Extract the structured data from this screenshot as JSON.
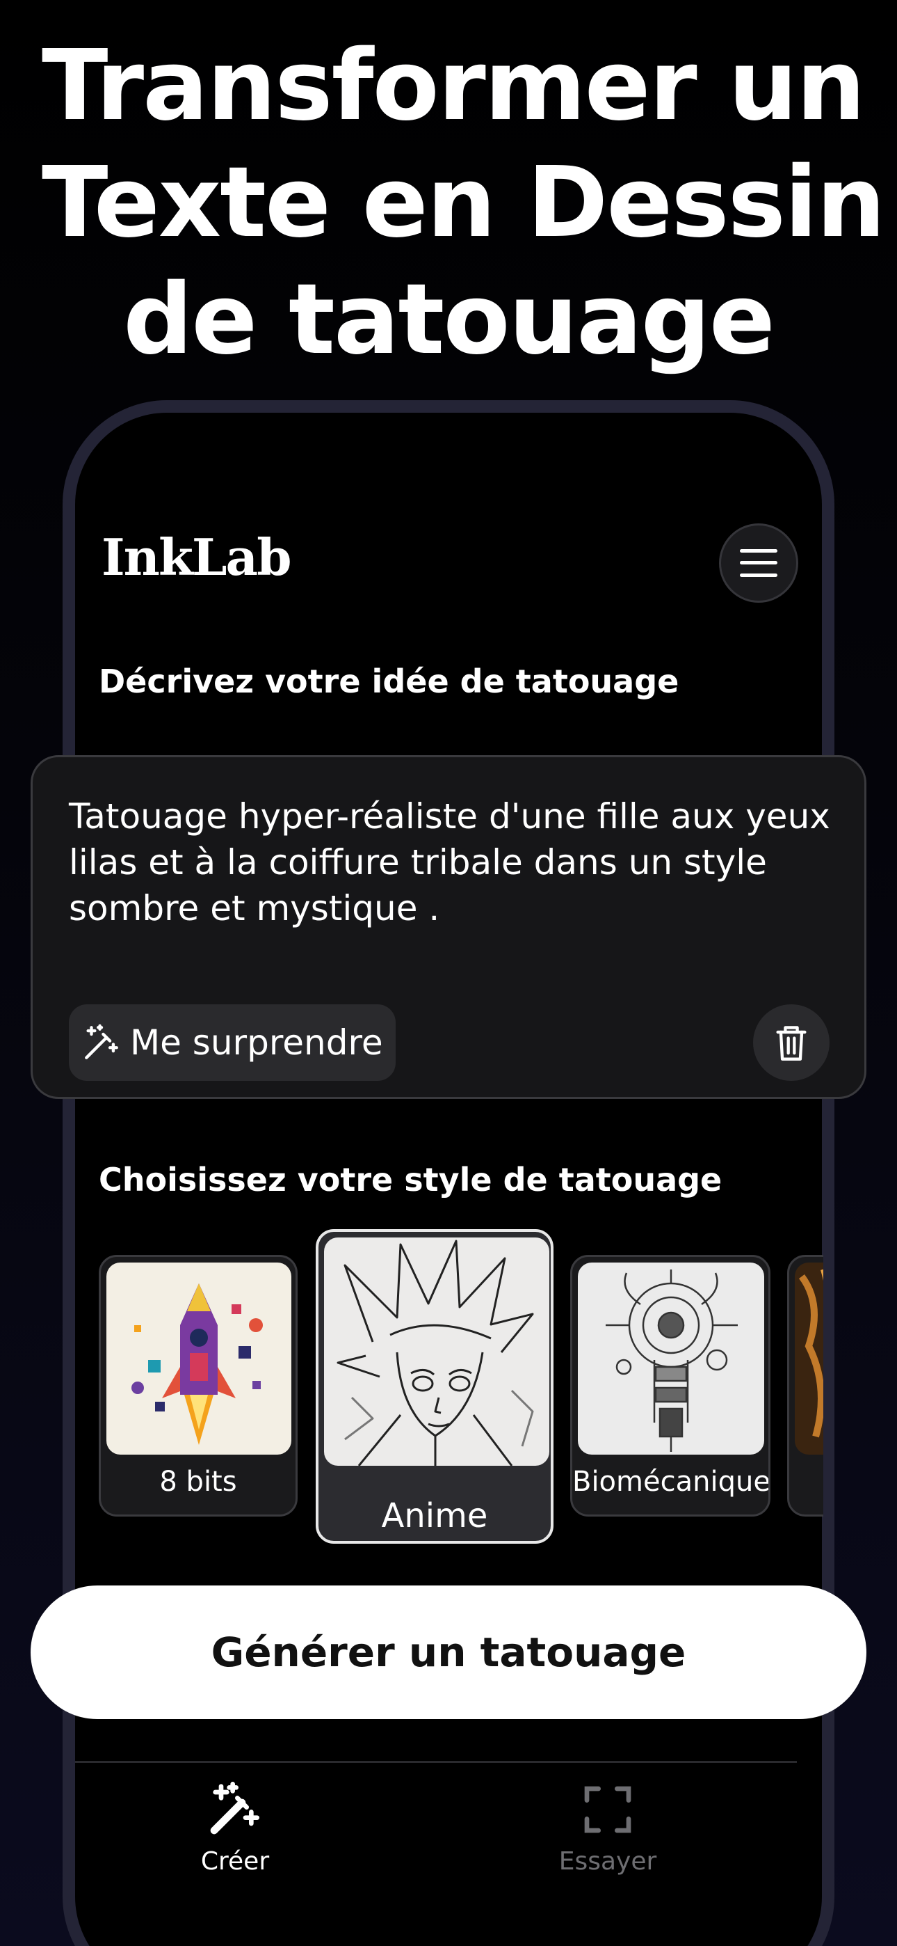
{
  "headline": {
    "line1": "Transformer un",
    "line2": "Texte en Dessin",
    "line3": "de tatouage"
  },
  "app": {
    "logo": "InkLab",
    "menu_icon": "hamburger-menu-icon"
  },
  "prompt_section": {
    "label": "Décrivez votre idée de tatouage",
    "text": "Tatouage hyper-réaliste d'une fille aux yeux lilas et à la coiffure tribale dans un style sombre et mystique .",
    "surprise_label": "Me surprendre",
    "surprise_icon": "magic-wand-icon",
    "delete_icon": "trash-icon"
  },
  "style_section": {
    "label": "Choisissez votre style de tatouage",
    "styles": [
      {
        "label": "8 bits",
        "selected": false
      },
      {
        "label": "Anime",
        "selected": true
      },
      {
        "label": "Biomécanique",
        "selected": false
      },
      {
        "label": "",
        "selected": false
      }
    ]
  },
  "generate_label": "Générer un tatouage",
  "bottom_nav": [
    {
      "label": "Créer",
      "icon": "magic-wand-icon",
      "active": true
    },
    {
      "label": "Essayer",
      "icon": "scan-frame-icon",
      "active": false
    }
  ],
  "colors": {
    "accent": "#ffffff",
    "inactive": "#6e6e72",
    "card": "#161618"
  }
}
